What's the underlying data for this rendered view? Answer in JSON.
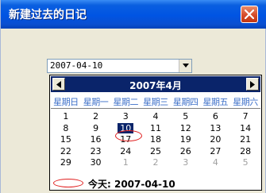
{
  "window": {
    "title": "新建过去的日记"
  },
  "date_picker": {
    "value": "2007-04-10"
  },
  "calendar": {
    "month_label": "2007年4月",
    "weekdays": [
      "星期日",
      "星期一",
      "星期二",
      "星期三",
      "星期四",
      "星期五",
      "星期六"
    ],
    "days": [
      {
        "n": "1",
        "other": false
      },
      {
        "n": "2",
        "other": false
      },
      {
        "n": "3",
        "other": false
      },
      {
        "n": "4",
        "other": false
      },
      {
        "n": "5",
        "other": false
      },
      {
        "n": "6",
        "other": false
      },
      {
        "n": "7",
        "other": false
      },
      {
        "n": "8",
        "other": false
      },
      {
        "n": "9",
        "other": false
      },
      {
        "n": "10",
        "other": false,
        "selected": true
      },
      {
        "n": "11",
        "other": false
      },
      {
        "n": "12",
        "other": false
      },
      {
        "n": "13",
        "other": false
      },
      {
        "n": "14",
        "other": false
      },
      {
        "n": "15",
        "other": false
      },
      {
        "n": "16",
        "other": false
      },
      {
        "n": "17",
        "other": false
      },
      {
        "n": "18",
        "other": false
      },
      {
        "n": "19",
        "other": false
      },
      {
        "n": "20",
        "other": false
      },
      {
        "n": "21",
        "other": false
      },
      {
        "n": "22",
        "other": false
      },
      {
        "n": "23",
        "other": false
      },
      {
        "n": "24",
        "other": false
      },
      {
        "n": "25",
        "other": false
      },
      {
        "n": "26",
        "other": false
      },
      {
        "n": "27",
        "other": false
      },
      {
        "n": "28",
        "other": false
      },
      {
        "n": "29",
        "other": false
      },
      {
        "n": "30",
        "other": false
      },
      {
        "n": "1",
        "other": true
      },
      {
        "n": "2",
        "other": true
      },
      {
        "n": "3",
        "other": true
      },
      {
        "n": "4",
        "other": true
      },
      {
        "n": "5",
        "other": true
      }
    ],
    "today_label": "今天: 2007-04-10"
  },
  "colors": {
    "titlebar": "#0054e3",
    "calendar_header": "#0a246a",
    "weekday_text": "#3c6fc9",
    "annotation_ring": "#e02020"
  }
}
